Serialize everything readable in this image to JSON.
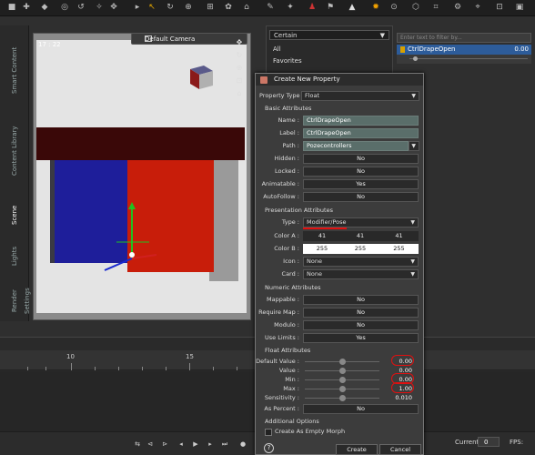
{
  "viewport": {
    "time": "17 : 22",
    "camera": "Default Camera"
  },
  "left_tabs": [
    "Smart Content",
    "Content Library",
    "Scene",
    "Lights",
    "Render Settings"
  ],
  "right_pane": {
    "dropdown": "Certain",
    "items": [
      "All",
      "Favorites"
    ],
    "vtab": "meters"
  },
  "params": {
    "filter_placeholder": "Enter text to filter by...",
    "row_label": "CtrlDrapeOpen",
    "row_value": "0.00"
  },
  "timeline": {
    "ticks": [
      "10",
      "15"
    ],
    "current_label": "Current:",
    "current_value": "0",
    "fps_label": "FPS:"
  },
  "dialog": {
    "title": "Create New Property",
    "property_type_label": "Property Type :",
    "property_type": "Float",
    "sections": {
      "basic": "Basic Attributes",
      "presentation": "Presentation Attributes",
      "numeric": "Numeric Attributes",
      "float": "Float Attributes",
      "additional": "Additional Options"
    },
    "basic": {
      "name_label": "Name :",
      "name": "CtrlDrapeOpen",
      "label_label": "Label :",
      "label": "CtrlDrapeOpen",
      "path_label": "Path :",
      "path": "Pozecontrollers",
      "hidden_label": "Hidden :",
      "hidden": "No",
      "locked_label": "Locked :",
      "locked": "No",
      "animatable_label": "Animatable :",
      "animatable": "Yes",
      "autofollow_label": "AutoFollow :",
      "autofollow": "No"
    },
    "presentation": {
      "type_label": "Type :",
      "type": "Modifier/Pose",
      "color_a_label": "Color A :",
      "color_a": [
        "41",
        "41",
        "41"
      ],
      "color_b_label": "Color B :",
      "color_b": [
        "255",
        "255",
        "255"
      ],
      "icon_label": "Icon :",
      "icon": "None",
      "card_label": "Card :",
      "card": "None"
    },
    "numeric": {
      "mappable_label": "Mappable :",
      "mappable": "No",
      "require_map_label": "Require Map :",
      "require_map": "No",
      "modulo_label": "Modulo :",
      "modulo": "No",
      "use_limits_label": "Use Limits :",
      "use_limits": "Yes"
    },
    "float": {
      "default_label": "Default Value :",
      "default": "0.00",
      "value_label": "Value :",
      "value": "0.00",
      "min_label": "Min :",
      "min": "0.00",
      "max_label": "Max :",
      "max": "1.00",
      "sensitivity_label": "Sensitivity :",
      "sensitivity": "0.010",
      "as_percent_label": "As Percent :",
      "as_percent": "No"
    },
    "additional": {
      "empty_morph": "Create As Empty Morph"
    },
    "help": "?",
    "create": "Create",
    "cancel": "Cancel"
  },
  "colors": {
    "accent_red": "#e01010",
    "selected_blue": "#2d5c9a"
  }
}
